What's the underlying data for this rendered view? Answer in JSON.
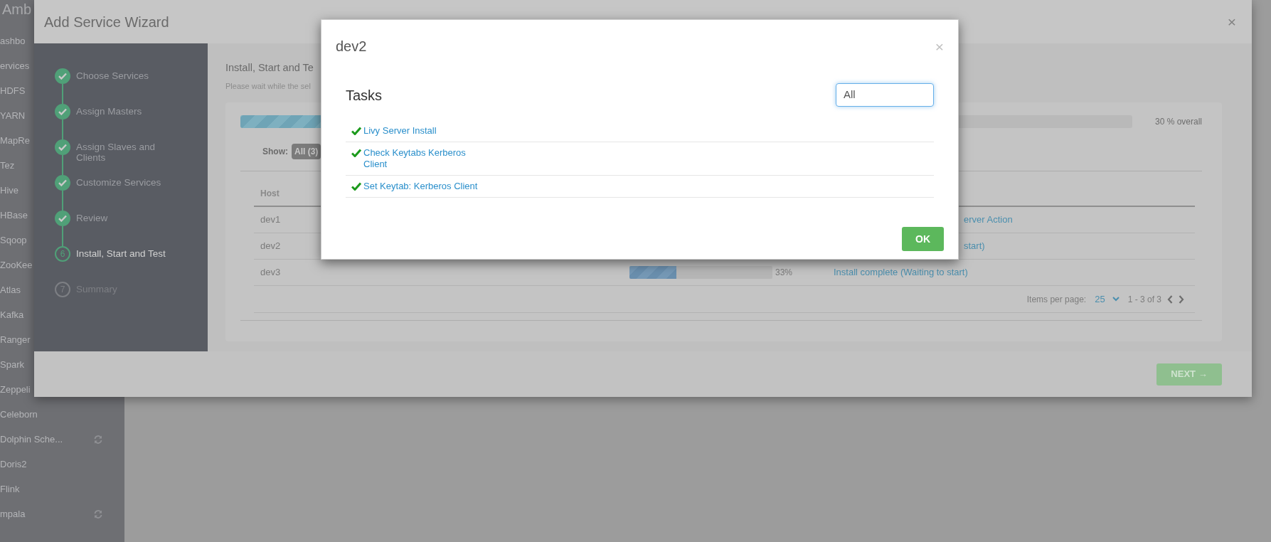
{
  "app_sidebar": {
    "title": "Amb",
    "items": [
      {
        "label": "ashbo",
        "syncing": false
      },
      {
        "label": "ervices",
        "syncing": false
      },
      {
        "label": "HDFS",
        "syncing": false
      },
      {
        "label": "YARN",
        "syncing": false
      },
      {
        "label": "MapRe",
        "syncing": false
      },
      {
        "label": "Tez",
        "syncing": false
      },
      {
        "label": "Hive",
        "syncing": false
      },
      {
        "label": "HBase",
        "syncing": false
      },
      {
        "label": "Sqoop",
        "syncing": false
      },
      {
        "label": "ZooKee",
        "syncing": false
      },
      {
        "label": "Atlas",
        "syncing": false
      },
      {
        "label": "Kafka",
        "syncing": false
      },
      {
        "label": "Ranger",
        "syncing": false
      },
      {
        "label": "Spark",
        "syncing": false
      },
      {
        "label": "Zeppeli",
        "syncing": false
      },
      {
        "label": "Celeborn",
        "syncing": false
      },
      {
        "label": "Dolphin Sche...",
        "syncing": true
      },
      {
        "label": "Doris2",
        "syncing": false
      },
      {
        "label": "Flink",
        "syncing": false
      },
      {
        "label": "mpala",
        "syncing": true
      }
    ]
  },
  "wizard": {
    "title": "Add Service Wizard",
    "close": "×",
    "steps": [
      {
        "label": "Choose Services",
        "done": true,
        "current": false
      },
      {
        "label": "Assign Masters",
        "done": true,
        "current": false
      },
      {
        "label": "Assign Slaves and Clients",
        "done": true,
        "current": false
      },
      {
        "label": "Customize Services",
        "done": true,
        "current": false
      },
      {
        "label": "Review",
        "done": true,
        "current": false
      },
      {
        "label": "Install, Start and Test",
        "done": false,
        "current": true,
        "number": "6"
      },
      {
        "label": "Summary",
        "done": false,
        "current": false,
        "number": "7"
      }
    ],
    "page_title": "Install, Start and Te",
    "page_subtitle": "Please wait while the sel",
    "overall_progress": {
      "level": 0.3,
      "reading": "30 % overall"
    },
    "filter": {
      "label": "Show:",
      "options": [
        {
          "label": "All (3)",
          "selected": true
        }
      ]
    },
    "hosts": {
      "columns": [
        "Host"
      ],
      "rows": [
        {
          "host": "dev1",
          "message": "erver Action"
        },
        {
          "host": "dev2",
          "message": "start)"
        },
        {
          "host": "dev3",
          "level": 0.33,
          "reading": "33%",
          "message": "Install complete (Waiting to start)"
        }
      ]
    },
    "pagination": {
      "label": "Items per page:",
      "per_page": "25",
      "range": "1 - 3 of 3"
    },
    "next_button": {
      "label": "NEXT →",
      "disabled": true
    }
  },
  "dialog": {
    "title": "dev2",
    "close": "×",
    "heading": "Tasks",
    "filter": {
      "value": "All"
    },
    "tasks": [
      {
        "label": "Livy Server Install",
        "completed": true
      },
      {
        "label": "Check Keytabs Kerberos Client",
        "completed": true
      },
      {
        "label": "Set Keytab: Kerberos Client",
        "completed": true
      }
    ],
    "ok_button": "OK"
  }
}
